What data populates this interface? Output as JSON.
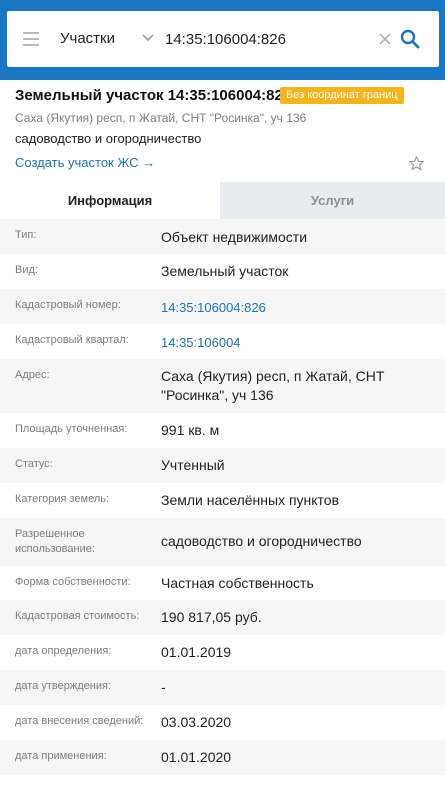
{
  "search": {
    "layer": "Участки",
    "query": "14:35:106004:826"
  },
  "object": {
    "title": "Земельный участок 14:35:106004:826",
    "badge": "Без координат границ",
    "address": "Саха (Якутия) респ, п Жатай, СНТ \"Росинка\", уч 136",
    "use": "садоводство и огородничество",
    "create_link": "Создать участок ЖС →"
  },
  "tabs": [
    {
      "label": "Информация",
      "active": true
    },
    {
      "label": "Услуги",
      "active": false
    }
  ],
  "rows": [
    {
      "label": "Тип:",
      "value": "Объект недвижимости"
    },
    {
      "label": "Вид:",
      "value": "Земельный участок"
    },
    {
      "label": "Кадастровый номер:",
      "value": "14:35:106004:826",
      "link": true
    },
    {
      "label": "Кадастровый квартал:",
      "value": "14:35:106004",
      "link": true
    },
    {
      "label": "Адрес:",
      "value": "Саха (Якутия) респ, п Жатай, СНТ \"Росинка\", уч 136"
    },
    {
      "label": "Площадь уточненная:",
      "value": "991 кв. м"
    },
    {
      "label": "Статус:",
      "value": "Учтенный"
    },
    {
      "label": "Категория земель:",
      "value": "Земли населённых пунктов"
    },
    {
      "label": "Разрешенное использование:",
      "value": "садоводство и огородничество"
    },
    {
      "label": "Форма собственности:",
      "value": "Частная собственность"
    },
    {
      "label": "Кадастровая стоимость:",
      "value": "190 817,05 руб."
    },
    {
      "label": "дата определения:",
      "value": "01.01.2019"
    },
    {
      "label": "дата утверждения:",
      "value": "-"
    },
    {
      "label": "дата внесения сведений:",
      "value": "03.03.2020"
    },
    {
      "label": "дата применения:",
      "value": "01.01.2020"
    }
  ],
  "colors": {
    "brand": "#1976c2",
    "link": "#1a73b5",
    "badge": "#f4b41a"
  }
}
